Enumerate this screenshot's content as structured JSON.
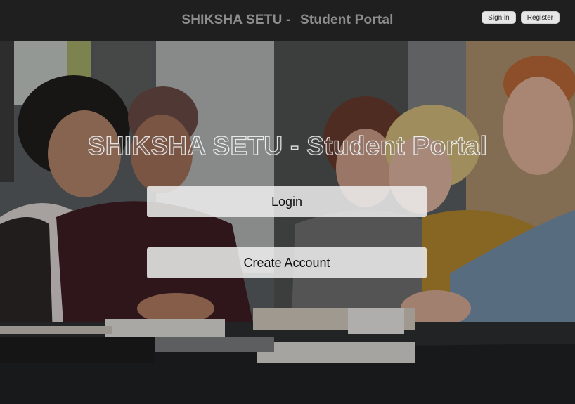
{
  "header": {
    "brand": "SHIKSHA SETU -",
    "subtitle": "Student Portal",
    "signin_label": "Sign in",
    "register_label": "Register"
  },
  "hero": {
    "heading": "SHIKSHA SETU - Student Portal",
    "background_image": "students-studying-together-photo",
    "login_label": "Login",
    "create_account_label": "Create Account"
  },
  "colors": {
    "topbar": "#1f1f1f",
    "title_text": "#8d8d8d",
    "button_bg": "#eeeeee"
  }
}
